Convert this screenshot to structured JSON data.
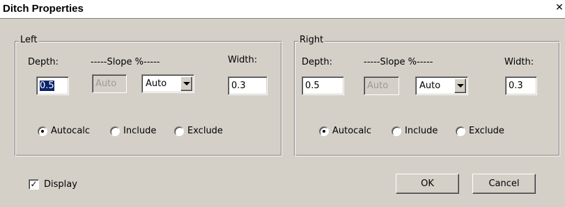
{
  "window": {
    "title": "Ditch Properties",
    "close_glyph": "✕"
  },
  "left": {
    "legend": "Left",
    "depth_label": "Depth:",
    "slope_label": "-----Slope %-----",
    "width_label": "Width:",
    "depth_value": "0.5",
    "slope_value": "Auto",
    "slope_mode": "Auto",
    "width_value": "0.3",
    "options": [
      "Autocalc",
      "Include",
      "Exclude"
    ],
    "selected_option": "Autocalc"
  },
  "right": {
    "legend": "Right",
    "depth_label": "Depth:",
    "slope_label": "-----Slope %-----",
    "width_label": "Width:",
    "depth_value": "0.5",
    "slope_value": "Auto",
    "slope_mode": "Auto",
    "width_value": "0.3",
    "options": [
      "Autocalc",
      "Include",
      "Exclude"
    ],
    "selected_option": "Autocalc"
  },
  "display": {
    "label": "Display",
    "checked": true,
    "check_glyph": "✓"
  },
  "buttons": {
    "ok": "OK",
    "cancel": "Cancel"
  },
  "icons": {
    "dropdown": "chevron-down-icon",
    "close": "close-icon",
    "radio_selected": "radio-selected-icon"
  },
  "colors": {
    "face": "#d4d0c8",
    "selection": "#0a246a"
  }
}
